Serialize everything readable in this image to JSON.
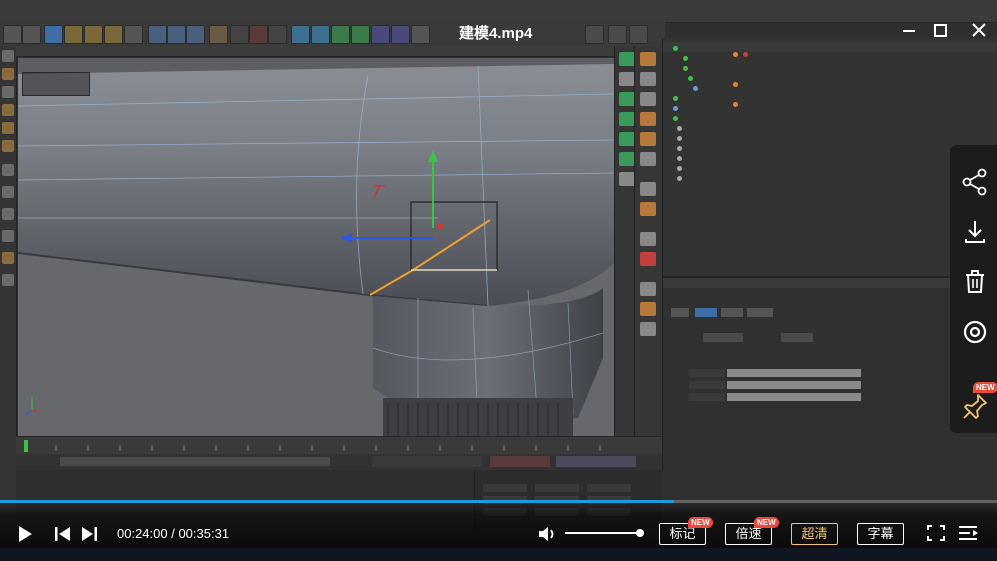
{
  "player": {
    "video_title": "建模4.mp4",
    "current_time": "00:24:00",
    "total_time": "00:35:31",
    "time_separator": " / ",
    "progress": 0.676,
    "volume": 1.0,
    "controls": {
      "mark_label": "标记",
      "speed_label": "倍速",
      "quality_label": "超清",
      "subtitle_label": "字幕",
      "new_badge": "NEW"
    },
    "side_actions": [
      "share-icon",
      "download-icon",
      "delete-icon",
      "view-icon",
      "pin-icon"
    ],
    "accent_color": "#1e9bd7",
    "badge_color": "#e84a3c",
    "quality_color": "#f2c66a"
  }
}
